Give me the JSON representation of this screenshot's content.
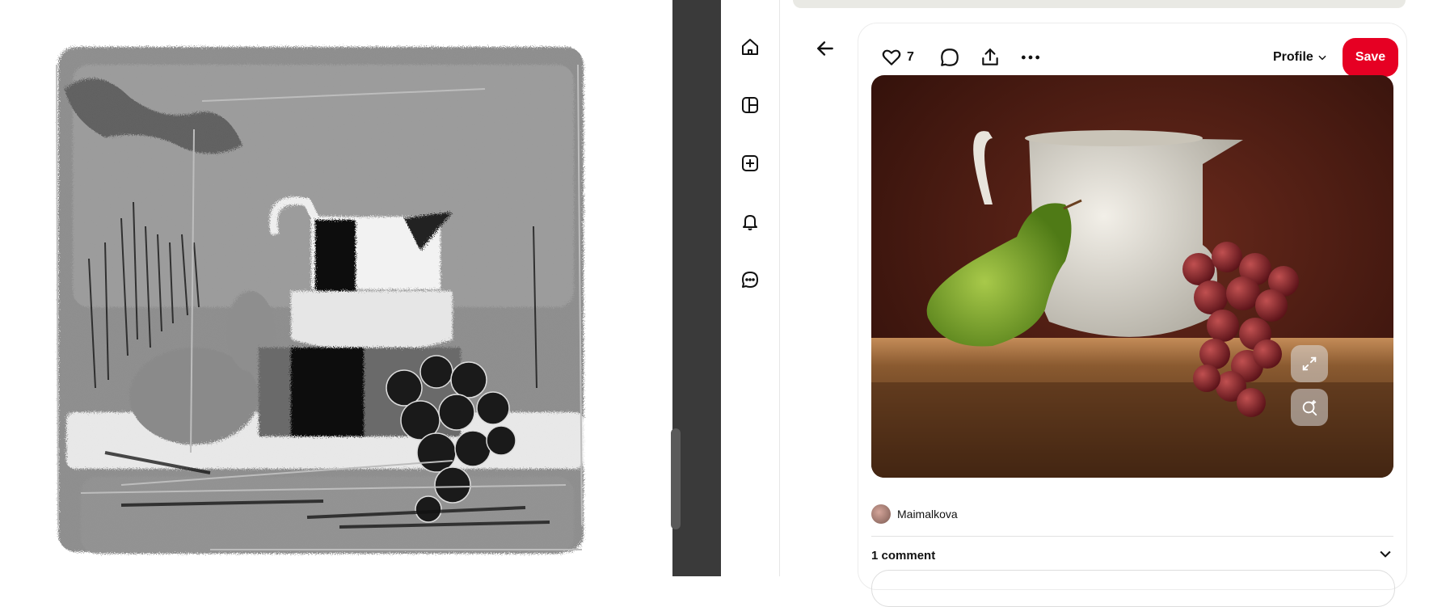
{
  "sketch": {
    "description_name": "grayscale-still-life-sketch"
  },
  "rail": {
    "items": [
      {
        "name": "home-icon"
      },
      {
        "name": "dashboard-icon"
      },
      {
        "name": "create-icon"
      },
      {
        "name": "notifications-icon"
      },
      {
        "name": "messages-icon"
      }
    ]
  },
  "pin": {
    "like_count": "7",
    "profile_label": "Profile",
    "save_label": "Save",
    "author_name": "Maimalkova",
    "comments_label": "1 comment"
  },
  "colors": {
    "save_red": "#e60023",
    "scroll_dark": "#3a3a3a"
  }
}
